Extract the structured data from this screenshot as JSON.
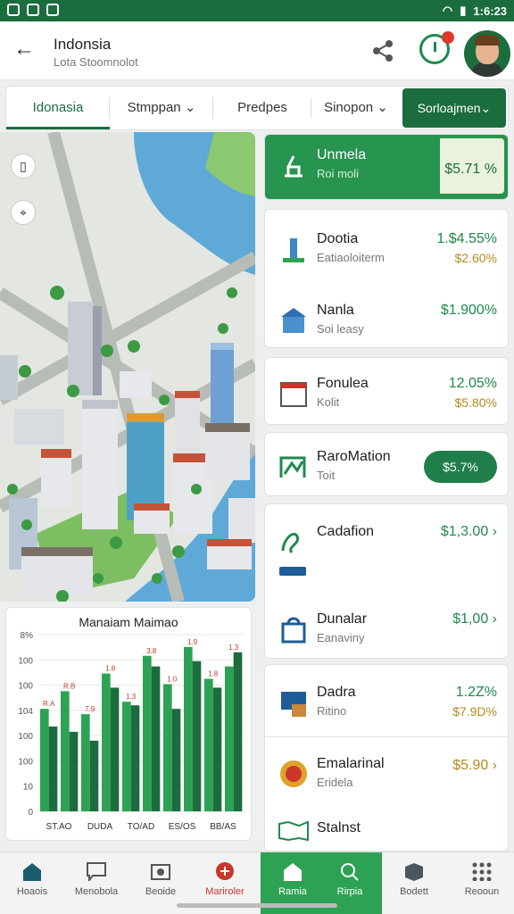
{
  "status": {
    "time": "1:6:23"
  },
  "header": {
    "title": "Indonsia",
    "subtitle": "Lota Stoomnolot"
  },
  "tabs": [
    {
      "label": "Idonasia"
    },
    {
      "label": "Stmppan ⌄"
    },
    {
      "label": "Predpes"
    },
    {
      "label": "Sinopon ⌄"
    }
  ],
  "tab_cta": {
    "label": "Sorloajmen⌄"
  },
  "chart_data": {
    "type": "bar",
    "title": "Manaiam Maimao",
    "yticks": [
      "8%",
      "100",
      "100",
      "104",
      "100",
      "100",
      "10",
      "0"
    ],
    "xticks": [
      "ST.AO",
      "DUDA",
      "TO/AD",
      "ES/OS",
      "BB/AS"
    ],
    "ylim": [
      0,
      100
    ],
    "series": [
      {
        "values": [
          58,
          68,
          55,
          78,
          62,
          88,
          72,
          93,
          75,
          82
        ]
      },
      {
        "values": [
          48,
          45,
          40,
          70,
          60,
          82,
          58,
          85,
          70,
          90
        ]
      }
    ],
    "bar_labels": [
      "R.A",
      "R.B",
      "7.9",
      "1.8",
      "1.3",
      "3.8",
      "1.0",
      "1.9",
      "1.8",
      "1.3"
    ],
    "colors": {
      "primary": "#2ea254",
      "dark": "#1b6d3e"
    }
  },
  "list": {
    "featured": {
      "name": "Unmela",
      "sub": "Roi moli",
      "value": "$5.71 %"
    },
    "items": [
      {
        "name": "Dootia",
        "sub": "Eatiaoloiterm",
        "value": "1.$4.55%",
        "value2": "$2.60%"
      },
      {
        "name": "Nanla",
        "sub": "Soi leasy",
        "value": "$1.900%"
      },
      {
        "name": "Fonulea",
        "sub": "Kolit",
        "value": "12.05%",
        "value2": "$5.80%"
      },
      {
        "name": "RaroMation",
        "sub": "Toit",
        "pill": "$5.7%"
      },
      {
        "name": "Cadafion",
        "value": "$1,3.00 ›"
      },
      {
        "name": "Dunalar",
        "sub": "Eanaviny",
        "value": "$1,00 ›"
      },
      {
        "name": "Dadra",
        "sub": "Ritino",
        "value": "1.2Z%",
        "value2": "$7.9D%"
      },
      {
        "name": "Emalarinal",
        "sub": "Eridela",
        "value2": "$5.90 ›"
      },
      {
        "name": "Stalnst"
      }
    ]
  },
  "bottom_nav": [
    {
      "label": "Hoaois",
      "icon": "home-icon"
    },
    {
      "label": "Menobola",
      "icon": "chat-icon"
    },
    {
      "label": "Beoide",
      "icon": "camera-icon"
    },
    {
      "label": "Mariroler",
      "icon": "alert-icon"
    },
    {
      "label": "Ramia",
      "icon": "home-icon"
    },
    {
      "label": "Rirpia",
      "icon": "search-icon"
    },
    {
      "label": "Bodett",
      "icon": "box-icon"
    },
    {
      "label": "Reooun",
      "icon": "grid-icon"
    }
  ]
}
